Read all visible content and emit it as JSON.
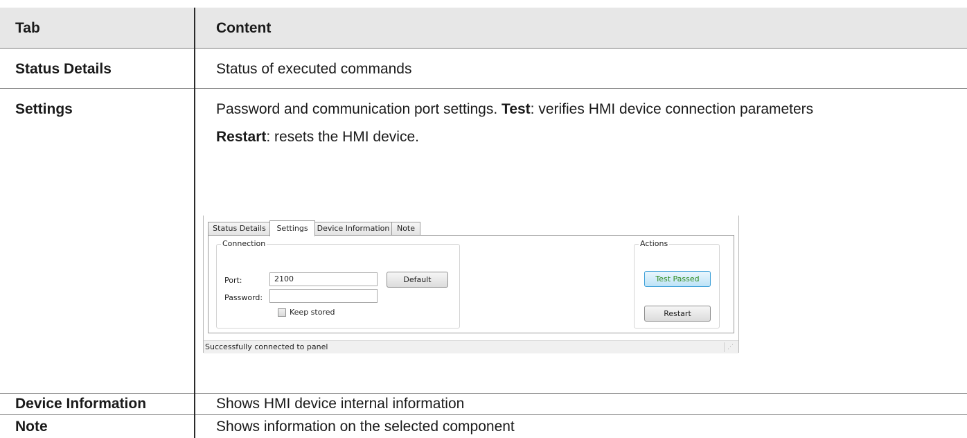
{
  "table": {
    "headers": {
      "tab": "Tab",
      "content": "Content"
    },
    "rows": [
      {
        "tab": "Status Details",
        "content": "Status of executed commands"
      },
      {
        "tab": "Settings",
        "content_part1": "Password and communication port settings. ",
        "test_keyword": "Test",
        "content_part2": ": verifies HMI device connection parameters",
        "restart_keyword": "Restart",
        "content_part3": ": resets the HMI device."
      },
      {
        "tab": "Device Information",
        "content": "Shows HMI device internal information"
      },
      {
        "tab": "Note",
        "content": "Shows information on the selected component"
      }
    ]
  },
  "dialog": {
    "tabs": [
      "Status Details",
      "Settings",
      "Device Information",
      "Note"
    ],
    "active_tab": "Settings",
    "connection_group": {
      "title": "Connection",
      "port_label": "Port:",
      "port_value": "2100",
      "default_button": "Default",
      "password_label": "Password:",
      "password_value": "",
      "keep_stored_label": "Keep stored",
      "keep_stored_checked": false
    },
    "actions_group": {
      "title": "Actions",
      "test_button": "Test Passed",
      "restart_button": "Restart"
    },
    "status_bar": "Successfully connected to panel"
  },
  "colors": {
    "header_bg": "#e7e7e7",
    "test_passed_text": "#2d8a1e",
    "test_passed_border": "#3c9fd8"
  }
}
